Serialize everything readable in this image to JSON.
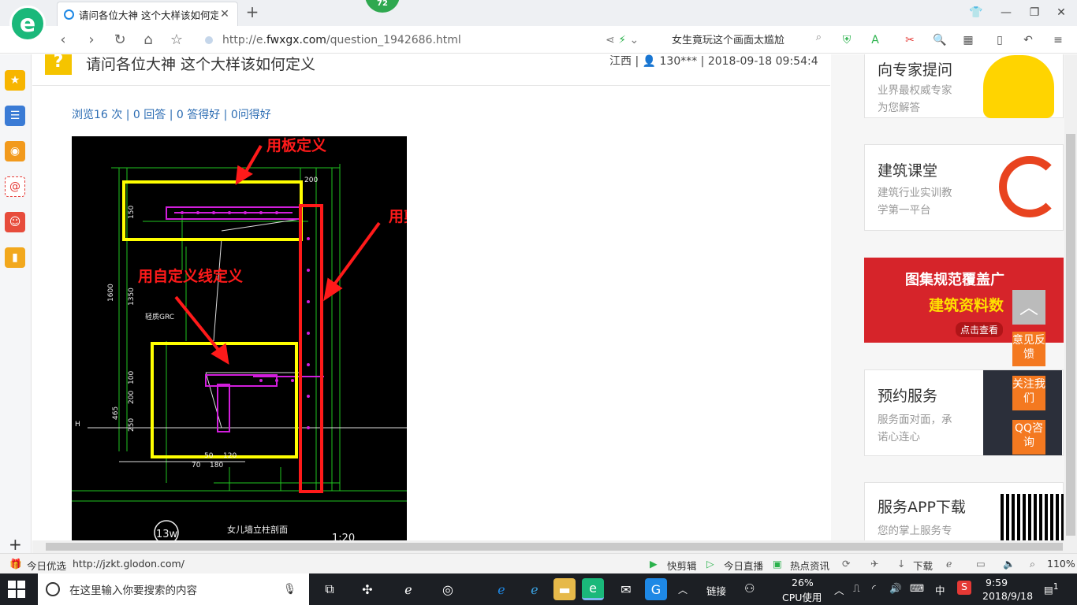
{
  "browser": {
    "tab_title": "请问各位大神 这个大样该如何定",
    "badge_count": "72",
    "url_prefix": "http://e.",
    "url_domain": "fwxgx.com",
    "url_path": "/question_1942686.html",
    "search_text": "女生竟玩这个画面太尴尬",
    "icons": [
      "back-icon",
      "forward-icon",
      "refresh-icon",
      "home-icon",
      "star-icon",
      "share-icon",
      "lightning-icon",
      "search-icon"
    ]
  },
  "question": {
    "title": "请问各位大神 这个大样该如何定义",
    "meta": "江西 | 👤 130*** | 2018-09-18 09:54:4",
    "stats": "浏览16 次 | 0 回答 | 0 答得好 | 0问得好",
    "icon_glyph": "?"
  },
  "cad": {
    "annotations": {
      "top": "用板定义",
      "right": "用剪力墙定义",
      "left": "用自定义线定义"
    },
    "labels": {
      "dims_top": "200",
      "v1": "1600",
      "v2": "1350",
      "v3": "465",
      "v4": "200",
      "v5": "250",
      "v6": "150",
      "v7": "100",
      "grc": "轻质GRC",
      "bottom_title": "女儿墙立柱剖面",
      "scale": "1:20",
      "circle_ref": "13w",
      "h_mark": "H",
      "d1": "70",
      "d2": "180",
      "d3": "50",
      "d4": "120"
    }
  },
  "right": {
    "card1_title": "向专家提问",
    "card1_sub1": "业界最权威专家",
    "card1_sub2": "为您解答",
    "card2_title": "建筑课堂",
    "card2_sub1": "建筑行业实训教",
    "card2_sub2": "学第一平台",
    "promo1": "图集规范覆盖广",
    "promo2": "建筑资料数",
    "promo3": "点击查看",
    "card3_title": "预约服务",
    "card3_sub1": "服务面对面，承",
    "card3_sub2": "诺心连心",
    "card4_title": "服务APP下载",
    "card4_sub1": "您的掌上服务专",
    "float1": "意见反馈",
    "float2": "关注我们",
    "float3": "QQ咨询"
  },
  "statusbar": {
    "left1": "今日优选",
    "left2": "http://jzkt.glodon.com/",
    "r1": "快剪辑",
    "r2": "今日直播",
    "r3": "热点资讯",
    "r4": "下载",
    "zoom": "110%"
  },
  "taskbar": {
    "search_placeholder": "在这里输入你要搜索的内容",
    "link_label": "链接",
    "cpu_pct": "26%",
    "cpu_label": "CPU使用",
    "ime": "中",
    "time": "9:59",
    "date": "2018/9/18",
    "notif": "1"
  }
}
